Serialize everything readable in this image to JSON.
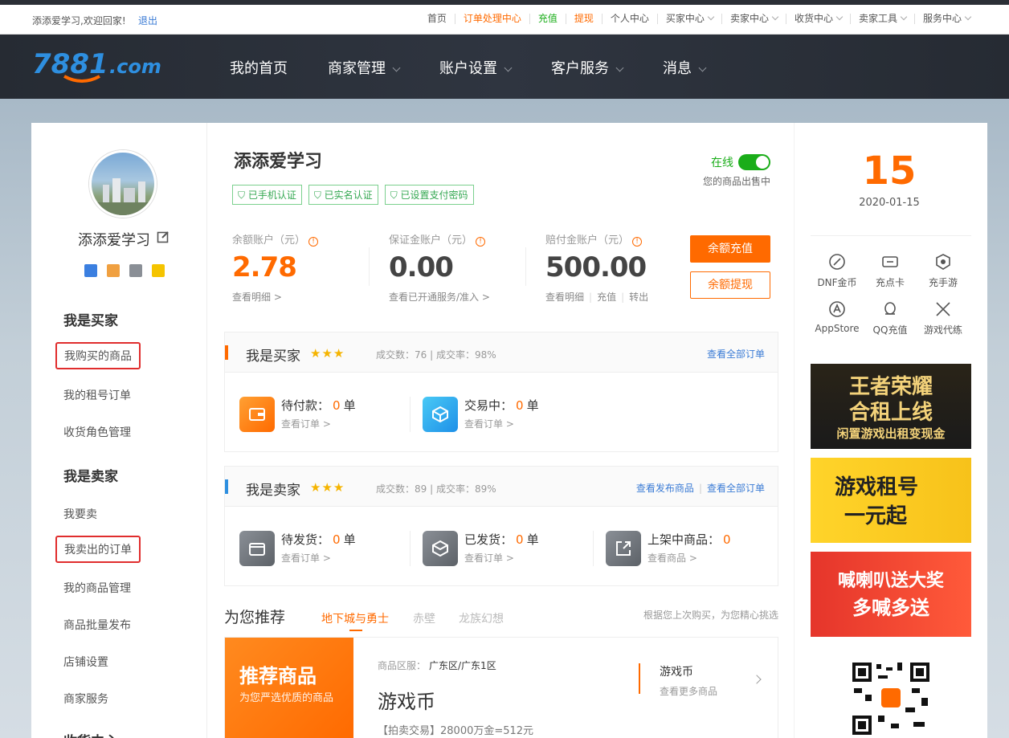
{
  "topbar": {
    "welcome": "添添爱学习,欢迎回家!",
    "logout": "退出",
    "nav": [
      {
        "label": "首页",
        "style": "normal",
        "dropdown": false
      },
      {
        "label": "订单处理中心",
        "style": "orange",
        "dropdown": false
      },
      {
        "label": "充值",
        "style": "green",
        "dropdown": false
      },
      {
        "label": "提现",
        "style": "orange",
        "dropdown": false
      },
      {
        "label": "个人中心",
        "style": "normal",
        "dropdown": false
      },
      {
        "label": "买家中心",
        "style": "normal",
        "dropdown": true
      },
      {
        "label": "卖家中心",
        "style": "normal",
        "dropdown": true
      },
      {
        "label": "收货中心",
        "style": "normal",
        "dropdown": true
      },
      {
        "label": "卖家工具",
        "style": "normal",
        "dropdown": true
      },
      {
        "label": "服务中心",
        "style": "normal",
        "dropdown": true
      }
    ]
  },
  "header": {
    "logo_text": "7881.com",
    "nav": [
      "我的首页",
      "商家管理",
      "账户设置",
      "客户服务",
      "消息"
    ],
    "nav_dropdown": [
      false,
      true,
      true,
      true,
      true
    ]
  },
  "sidebar": {
    "username": "添添爱学习",
    "buyer_title": "我是买家",
    "buyer_items": [
      "我购买的商品",
      "我的租号订单",
      "收货角色管理"
    ],
    "seller_title": "我是卖家",
    "seller_items": [
      "我要卖",
      "我卖出的订单",
      "我的商品管理",
      "商品批量发布",
      "店铺设置",
      "商家服务"
    ],
    "next_section_title": "收货中心"
  },
  "profile": {
    "shop_name": "添添爱学习",
    "verifications": [
      "已手机认证",
      "已实名认证",
      "已设置支付密码"
    ],
    "status_label": "在线",
    "status_sub": "您的商品出售中"
  },
  "accounts": [
    {
      "label": "余额账户（元）",
      "value": "2.78",
      "links": [
        "查看明细 >"
      ]
    },
    {
      "label": "保证金账户（元）",
      "value": "0.00",
      "links": [
        "查看已开通服务/准入 >"
      ]
    },
    {
      "label": "赔付金账户（元）",
      "value": "500.00",
      "links": [
        "查看明细",
        "充值",
        "转出"
      ]
    }
  ],
  "buttons": {
    "recharge": "余额充值",
    "withdraw": "余额提现"
  },
  "buyer_panel": {
    "title": "我是买家",
    "stars": "★★★",
    "stats": "成交数：76 | 成交率：98%",
    "links": [
      "查看全部订单"
    ],
    "items": [
      {
        "name": "待付款：",
        "count": "0",
        "unit": "单",
        "link": "查看订单 >"
      },
      {
        "name": "交易中：",
        "count": "0",
        "unit": "单",
        "link": "查看订单 >"
      }
    ]
  },
  "seller_panel": {
    "title": "我是卖家",
    "stars": "★★★",
    "stats": "成交数：89 | 成交率：89%",
    "links": [
      "查看发布商品",
      "查看全部订单"
    ],
    "items": [
      {
        "name": "待发货：",
        "count": "0",
        "unit": "单",
        "link": "查看订单 >"
      },
      {
        "name": "已发货：",
        "count": "0",
        "unit": "单",
        "link": "查看订单 >"
      },
      {
        "name": "上架中商品：",
        "count": "0",
        "unit": "",
        "link": "查看商品 >"
      }
    ]
  },
  "recommend": {
    "title": "为您推荐",
    "tabs": [
      "地下城与勇士",
      "赤壁",
      "龙族幻想"
    ],
    "hint": "根据您上次购买，为您精心挑选",
    "card": {
      "banner_title": "推荐商品",
      "banner_sub": "为您严选优质的商品",
      "zone_label": "商品区服：",
      "zone_value": "广东区/广东1区",
      "name": "游戏币",
      "desc": "【拍卖交易】28000万金=512元",
      "side_title": "游戏币",
      "side_link": "查看更多商品"
    }
  },
  "right": {
    "day": "15",
    "date": "2020-01-15",
    "quick": [
      {
        "label": "DNF金币",
        "icon": "dnf-coin-icon"
      },
      {
        "label": "充点卡",
        "icon": "card-icon"
      },
      {
        "label": "充手游",
        "icon": "mobile-game-icon"
      },
      {
        "label": "AppStore",
        "icon": "appstore-icon"
      },
      {
        "label": "QQ充值",
        "icon": "qq-icon"
      },
      {
        "label": "游戏代练",
        "icon": "swords-icon"
      }
    ],
    "ads": [
      {
        "line1": "王者荣耀",
        "line2": "合租上线",
        "line3": "闲置游戏出租变现金"
      },
      {
        "line1": "游戏租号",
        "line2": "一元起"
      },
      {
        "line1": "喊喇叭送大奖",
        "line2": "多喊多送"
      }
    ]
  }
}
